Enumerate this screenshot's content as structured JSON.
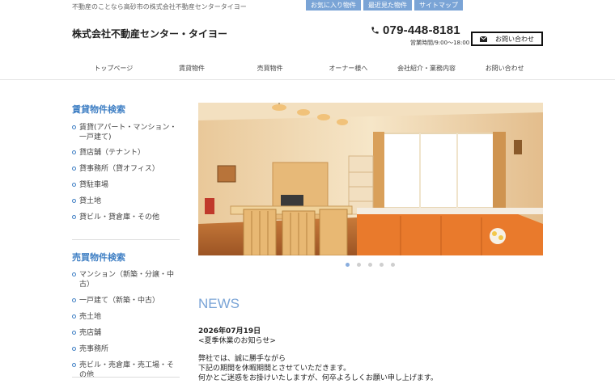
{
  "top": {
    "tagline": "不動産のことなら高砂市の株式会社不動産センタータイヨー",
    "links": [
      "お気に入り物件",
      "最近見た物件",
      "サイトマップ"
    ]
  },
  "header": {
    "company": "株式会社不動産センター・タイヨー",
    "phone": "079-448-8181",
    "hours": "営業時間/9:00～18:00",
    "contact_label": "お問い合わせ"
  },
  "nav": [
    "トップページ",
    "賃貸物件",
    "売買物件",
    "オーナー様へ",
    "会社紹介・業務内容",
    "お問い合わせ"
  ],
  "sidebar": {
    "rent": {
      "heading": "賃貸物件検索",
      "items": [
        "賃貸(アパート・マンション・一戸建て)",
        "貸店舗（テナント）",
        "貸事務所（貸オフィス）",
        "貸駐車場",
        "貸土地",
        "貸ビル・貸倉庫・その他"
      ]
    },
    "sale": {
      "heading": "売買物件検索",
      "items": [
        "マンション（新築・分譲・中古）",
        "一戸建て（新築・中古）",
        "売土地",
        "売店舗",
        "売事務所",
        "売ビル・売倉庫・売工場・その他"
      ]
    }
  },
  "slider": {
    "image": "kitchen-dining-room-photo",
    "slide_count": 5,
    "active_slide": 1
  },
  "news": {
    "title": "NEWS",
    "date": "2026年07月19日",
    "subject": "<夏季休業のお知らせ>",
    "body": [
      "弊社では、誠に勝手ながら",
      "下記の期間を休暇期間とさせていただきます。",
      "何かとご迷惑をお掛けいたしますが、何卒よろしくお願い申し上げます。"
    ]
  },
  "colors": {
    "accent": "#3f7fc4",
    "toplink_bg": "#7aa4d6",
    "news_title": "#7aa4d6"
  }
}
